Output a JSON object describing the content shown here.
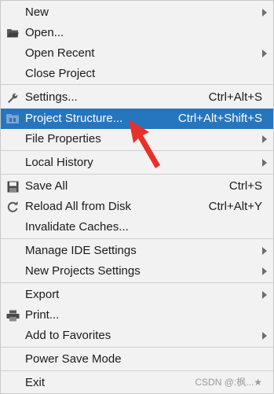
{
  "menu": {
    "items": [
      {
        "label": "New",
        "shortcut": "",
        "submenu": true,
        "icon": ""
      },
      {
        "label": "Open...",
        "shortcut": "",
        "submenu": false,
        "icon": "folder-icon"
      },
      {
        "label": "Open Recent",
        "shortcut": "",
        "submenu": true,
        "icon": ""
      },
      {
        "label": "Close Project",
        "shortcut": "",
        "submenu": false,
        "icon": ""
      },
      {
        "label": "Settings...",
        "shortcut": "Ctrl+Alt+S",
        "submenu": false,
        "icon": "wrench-icon"
      },
      {
        "label": "Project Structure...",
        "shortcut": "Ctrl+Alt+Shift+S",
        "submenu": false,
        "icon": "project-structure-icon",
        "selected": true
      },
      {
        "label": "File Properties",
        "shortcut": "",
        "submenu": true,
        "icon": ""
      },
      {
        "label": "Local History",
        "shortcut": "",
        "submenu": true,
        "icon": ""
      },
      {
        "label": "Save All",
        "shortcut": "Ctrl+S",
        "submenu": false,
        "icon": "save-icon"
      },
      {
        "label": "Reload All from Disk",
        "shortcut": "Ctrl+Alt+Y",
        "submenu": false,
        "icon": "reload-icon"
      },
      {
        "label": "Invalidate Caches...",
        "shortcut": "",
        "submenu": false,
        "icon": ""
      },
      {
        "label": "Manage IDE Settings",
        "shortcut": "",
        "submenu": true,
        "icon": ""
      },
      {
        "label": "New Projects Settings",
        "shortcut": "",
        "submenu": true,
        "icon": ""
      },
      {
        "label": "Export",
        "shortcut": "",
        "submenu": true,
        "icon": ""
      },
      {
        "label": "Print...",
        "shortcut": "",
        "submenu": false,
        "icon": "printer-icon"
      },
      {
        "label": "Add to Favorites",
        "shortcut": "",
        "submenu": true,
        "icon": ""
      },
      {
        "label": "Power Save Mode",
        "shortcut": "",
        "submenu": false,
        "icon": ""
      },
      {
        "label": "Exit",
        "shortcut": "",
        "submenu": false,
        "icon": ""
      }
    ]
  },
  "watermark": "CSDN @:枫...★",
  "colors": {
    "selection": "#2675bf",
    "background": "#f2f2f2",
    "pointer": "#e8302a"
  }
}
